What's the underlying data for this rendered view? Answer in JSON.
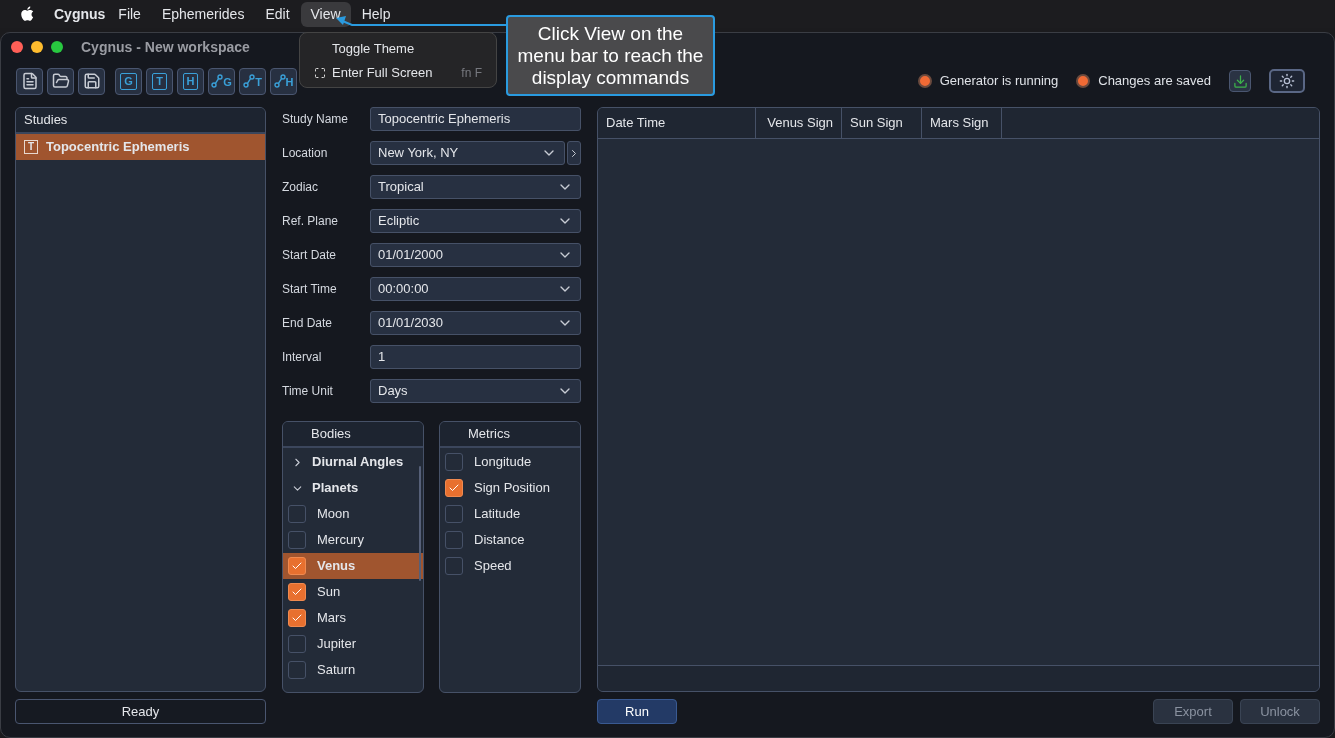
{
  "menu_bar": {
    "app_name": "Cygnus",
    "items": [
      {
        "label": "File",
        "selected": false
      },
      {
        "label": "Ephemerides",
        "selected": false
      },
      {
        "label": "Edit",
        "selected": false
      },
      {
        "label": "View",
        "selected": true
      },
      {
        "label": "Help",
        "selected": false
      }
    ]
  },
  "view_menu": {
    "items": [
      {
        "label": "Toggle Theme",
        "kind": "plain"
      },
      {
        "label": "Enter Full Screen",
        "kind": "fullscreen",
        "shortcut": "fn F"
      }
    ]
  },
  "callout": {
    "text": "Click View on the menu bar to reach the display commands"
  },
  "window": {
    "title": "Cygnus - New workspace"
  },
  "toolbar": {
    "buttons": [
      {
        "kind": "document"
      },
      {
        "kind": "folder"
      },
      {
        "kind": "disk"
      },
      {
        "kind": "letter",
        "label": "G"
      },
      {
        "kind": "letter",
        "label": "T"
      },
      {
        "kind": "letter",
        "label": "H"
      },
      {
        "kind": "branch",
        "label": "G"
      },
      {
        "kind": "branch",
        "label": "T"
      },
      {
        "kind": "branch",
        "label": "H"
      }
    ]
  },
  "indicators": [
    {
      "label": "Generator is running",
      "on": true
    },
    {
      "label": "Changes are saved",
      "on": true
    }
  ],
  "studies": {
    "title": "Studies",
    "items": [
      {
        "label": "Topocentric Ephemeris",
        "badge": "T",
        "selected": true
      }
    ]
  },
  "form": [
    {
      "label": "Study Name",
      "value": "Topocentric Ephemeris",
      "kind": "text"
    },
    {
      "label": "Location",
      "value": "New York, NY",
      "kind": "select_more"
    },
    {
      "label": "Zodiac",
      "value": "Tropical",
      "kind": "select"
    },
    {
      "label": "Ref. Plane",
      "value": "Ecliptic",
      "kind": "select"
    },
    {
      "label": "Start Date",
      "value": "01/01/2000",
      "kind": "select"
    },
    {
      "label": "Start Time",
      "value": "00:00:00",
      "kind": "select"
    },
    {
      "label": "End Date",
      "value": "01/01/2030",
      "kind": "select"
    },
    {
      "label": "Interval",
      "value": "1",
      "kind": "text"
    },
    {
      "label": "Time Unit",
      "value": "Days",
      "kind": "select"
    }
  ],
  "bodies": {
    "title": "Bodies",
    "items": [
      {
        "label": "Diurnal Angles",
        "expanded": false
      },
      {
        "label": "Planets",
        "expanded": true,
        "children": [
          {
            "label": "Moon",
            "checked": false,
            "selected": false
          },
          {
            "label": "Mercury",
            "checked": false,
            "selected": false
          },
          {
            "label": "Venus",
            "checked": true,
            "selected": true
          },
          {
            "label": "Sun",
            "checked": true,
            "selected": false
          },
          {
            "label": "Mars",
            "checked": true,
            "selected": false
          },
          {
            "label": "Jupiter",
            "checked": false,
            "selected": false
          },
          {
            "label": "Saturn",
            "checked": false,
            "selected": false
          }
        ]
      }
    ]
  },
  "metrics": {
    "title": "Metrics",
    "items": [
      {
        "label": "Longitude",
        "checked": false
      },
      {
        "label": "Sign Position",
        "checked": true
      },
      {
        "label": "Latitude",
        "checked": false
      },
      {
        "label": "Distance",
        "checked": false
      },
      {
        "label": "Speed",
        "checked": false
      }
    ]
  },
  "table": {
    "columns": [
      "Date Time",
      "Venus Sign",
      "Sun Sign",
      "Mars Sign"
    ]
  },
  "status": "Ready",
  "actions": [
    {
      "label": "Run",
      "kind": "primary",
      "disabled": false
    },
    {
      "label": "Export",
      "kind": "secondary",
      "disabled": true
    },
    {
      "label": "Unlock",
      "kind": "secondary",
      "disabled": true
    }
  ]
}
